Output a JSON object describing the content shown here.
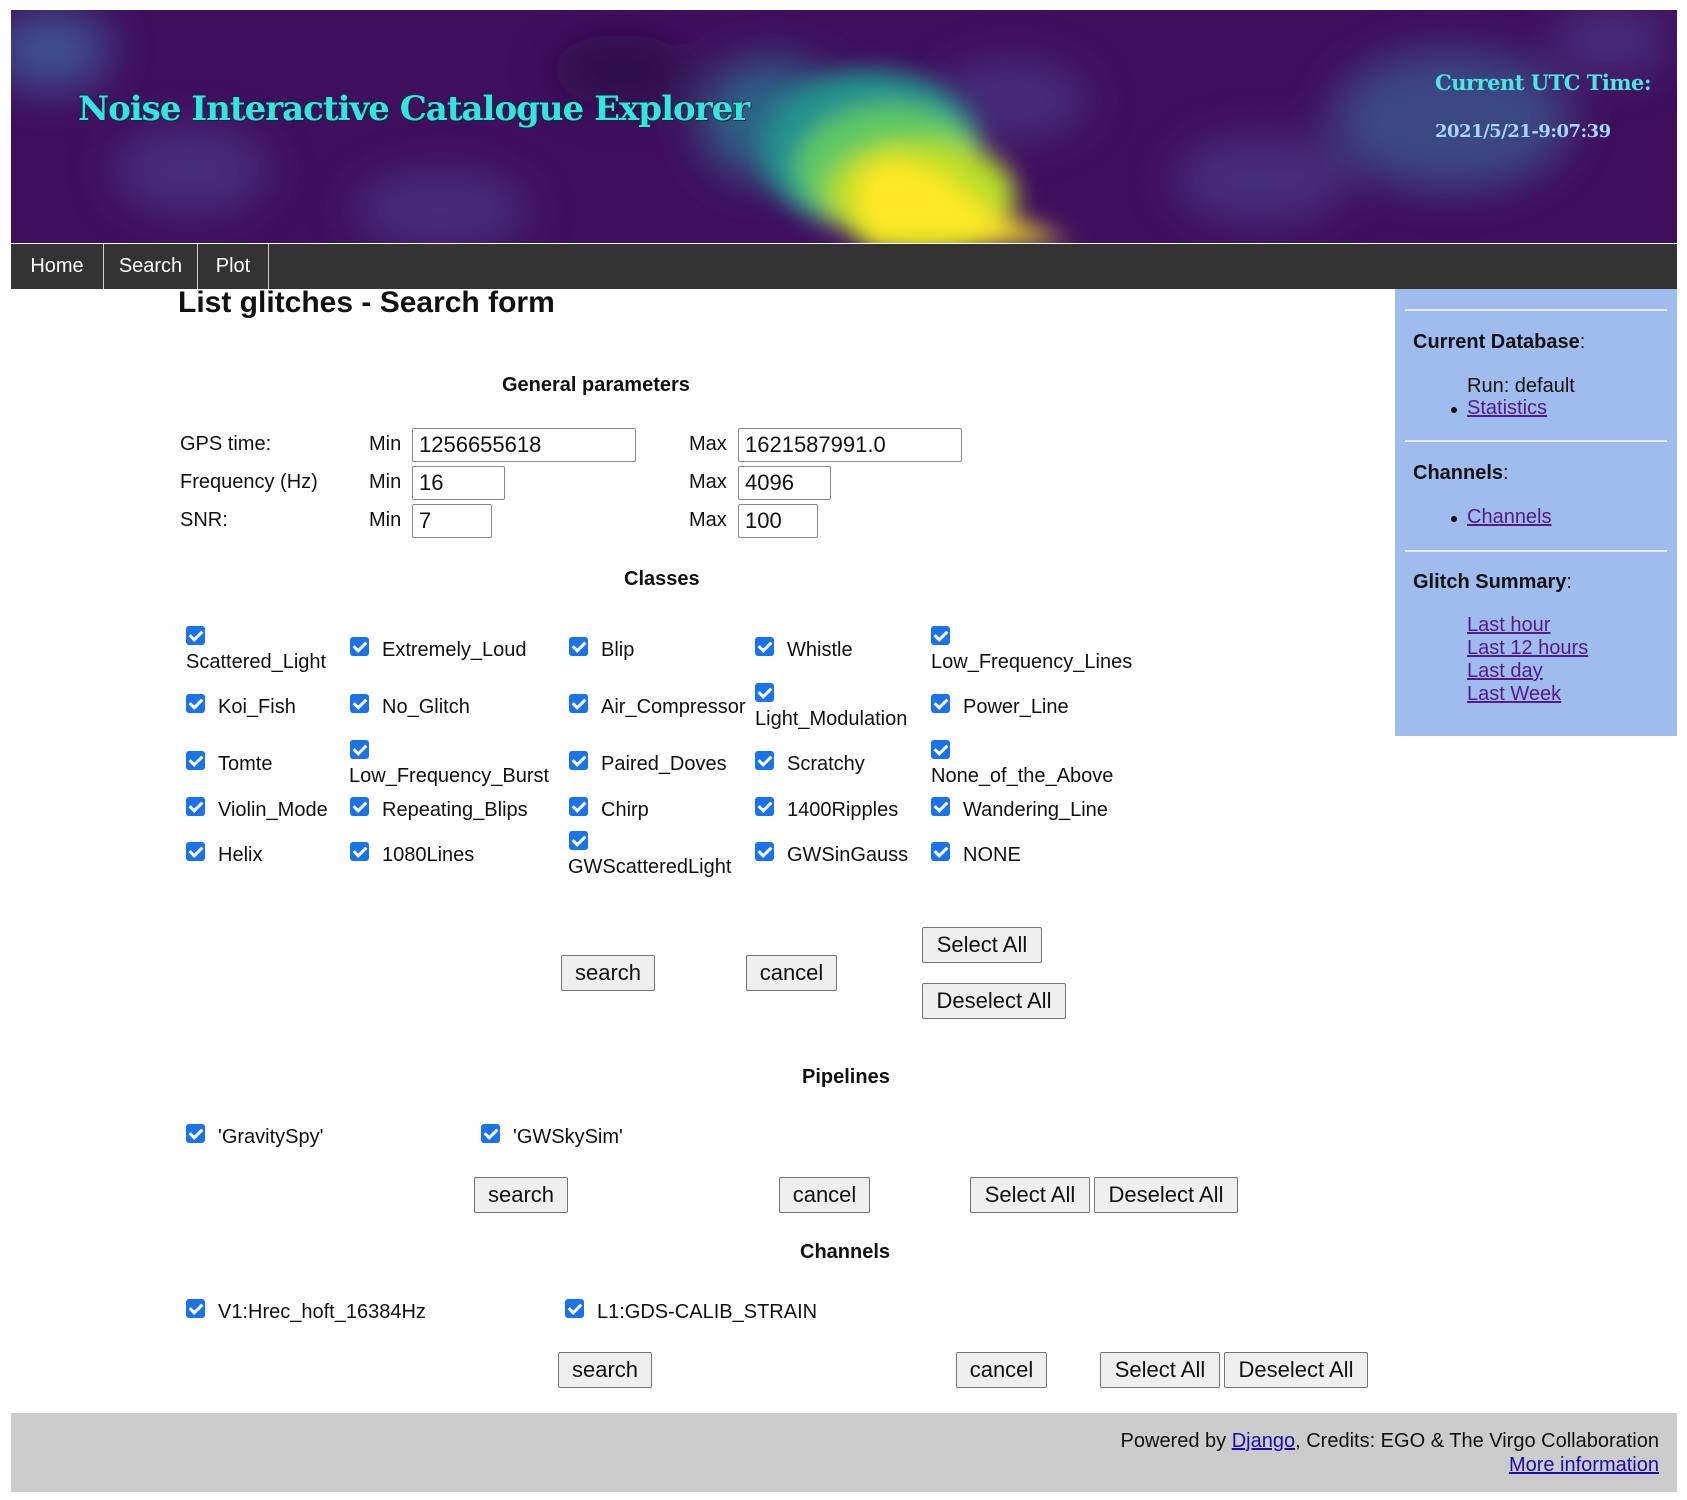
{
  "header": {
    "title": "Noise Interactive Catalogue Explorer",
    "utc_label": "Current UTC Time:",
    "utc_value": "2021/5/21-9:07:39"
  },
  "nav": {
    "items": [
      "Home",
      "Search",
      "Plot"
    ]
  },
  "page_title": "List glitches - Search form",
  "general": {
    "title": "General parameters",
    "rows": [
      {
        "label": "GPS time:",
        "min_label": "Min",
        "min": "1256655618",
        "max_label": "Max",
        "max": "1621587991.0"
      },
      {
        "label": "Frequency (Hz)",
        "min_label": "Min",
        "min": "16",
        "max_label": "Max",
        "max": "4096"
      },
      {
        "label": "SNR:",
        "min_label": "Min",
        "min": "7",
        "max_label": "Max",
        "max": "100"
      }
    ]
  },
  "classes": {
    "title": "Classes",
    "items": [
      "Scattered_Light",
      "Extremely_Loud",
      "Blip",
      "Whistle",
      "Low_Frequency_Lines",
      "Koi_Fish",
      "No_Glitch",
      "Air_Compressor",
      "Light_Modulation",
      "Power_Line",
      "Tomte",
      "Low_Frequency_Burst",
      "Paired_Doves",
      "Scratchy",
      "None_of_the_Above",
      "Violin_Mode",
      "Repeating_Blips",
      "Chirp",
      "1400Ripples",
      "Wandering_Line",
      "Helix",
      "1080Lines",
      "GWScatteredLight",
      "GWSinGauss",
      "NONE"
    ],
    "checked": true
  },
  "pipelines": {
    "title": "Pipelines",
    "items": [
      "'GravitySpy'",
      "'GWSkySim'"
    ],
    "checked": true
  },
  "channels": {
    "title": "Channels",
    "items": [
      "V1:Hrec_hoft_16384Hz",
      "L1:GDS-CALIB_STRAIN"
    ],
    "checked": true
  },
  "buttons": {
    "search": "search",
    "cancel": "cancel",
    "select_all": "Select All",
    "deselect_all": "Deselect All"
  },
  "sidebar": {
    "current_db_label": "Current Database",
    "run": "Run: default",
    "statistics": "Statistics",
    "channels_label": "Channels",
    "channels_link": "Channels",
    "glitch_summary_label": "Glitch Summary",
    "summary_links": [
      "Last hour",
      "Last 12 hours",
      "Last day",
      "Last Week"
    ]
  },
  "footer": {
    "powered_by": "Powered by",
    "django": "Django",
    "credits": ", Credits: EGO & The Virgo Collaboration",
    "more_info": "More information"
  },
  "colors": {
    "banner_purple": "#3f0f5e",
    "title_cyan": "#36e3df",
    "nav_bg": "#333333",
    "sidebar_bg": "#9ebcee",
    "checkbox_blue": "#1a73e8",
    "link_visited": "#551a8b",
    "footer_bg": "#cccccc"
  }
}
